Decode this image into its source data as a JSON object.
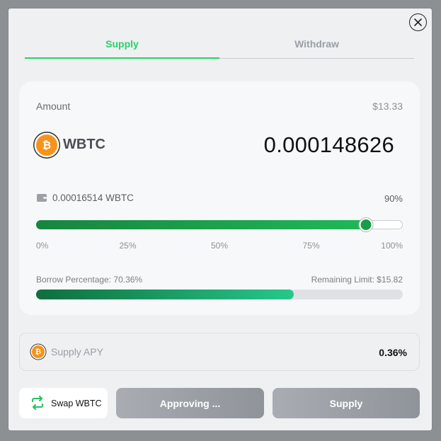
{
  "tabs": [
    {
      "label": "Supply",
      "active": true
    },
    {
      "label": "Withdraw",
      "active": false
    }
  ],
  "amount": {
    "label": "Amount",
    "usd_value": "$13.33",
    "token": "WBTC",
    "token_icon": "bitcoin-icon",
    "value": "0.000148626"
  },
  "wallet": {
    "icon": "wallet-icon",
    "balance": "0.00016514 WBTC",
    "percent_label": "90%"
  },
  "slider": {
    "value_fraction": 0.9,
    "ticks": [
      "0%",
      "25%",
      "50%",
      "75%",
      "100%"
    ]
  },
  "borrow": {
    "label": "Borrow Percentage: 70.36%",
    "remaining": "Remaining Limit: $15.82",
    "fraction": 0.7036
  },
  "apy": {
    "label": "Supply APY",
    "value": "0.36%"
  },
  "buttons": {
    "swap": "Swap WBTC",
    "approving": "Approving ...",
    "supply": "Supply"
  },
  "colors": {
    "accent": "#25d366",
    "slider_fill": "#1fb957",
    "bitcoin": "#f7931a",
    "button_disabled": "#9ea2a8"
  }
}
